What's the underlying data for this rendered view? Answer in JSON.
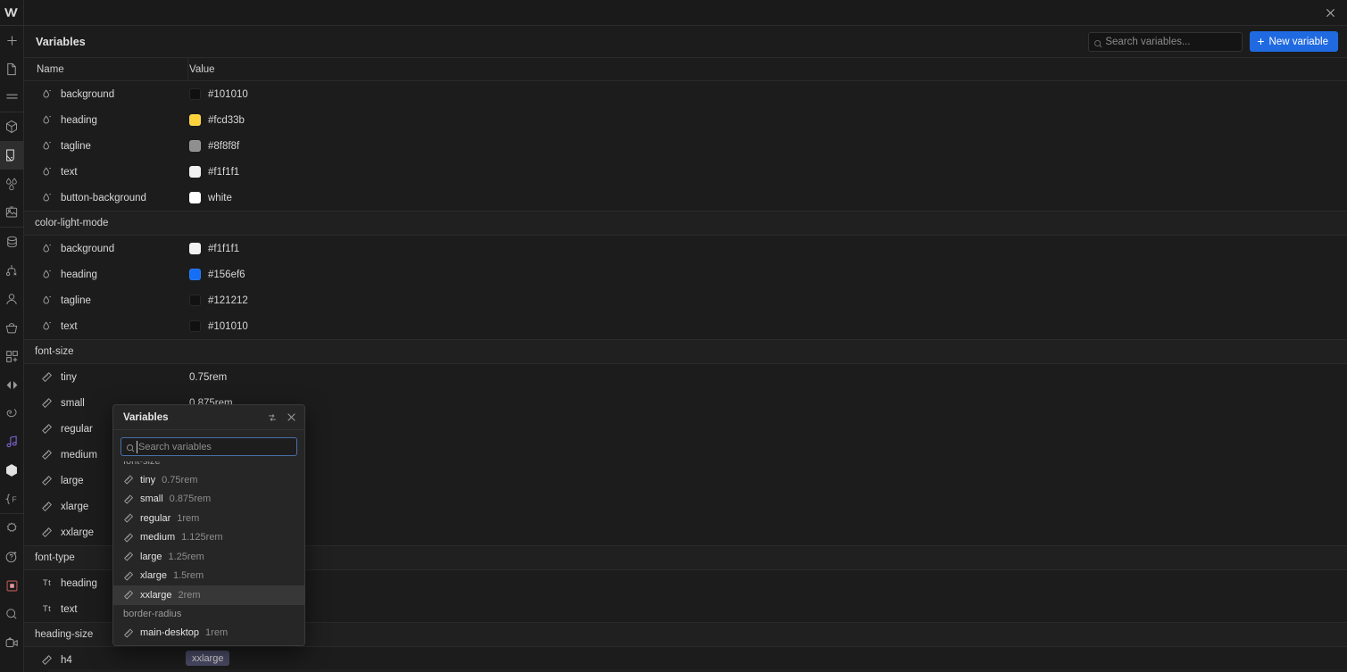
{
  "toolbar": {
    "logo": "webflow-logo",
    "items": [
      {
        "name": "add-element",
        "icon": "plus-icon"
      },
      {
        "name": "pages",
        "icon": "page-icon"
      },
      {
        "name": "navigator",
        "icon": "navigator-icon"
      },
      {
        "name": "components",
        "icon": "cube-icon"
      },
      {
        "name": "style-panel",
        "icon": "paint-brush-icon",
        "active": true
      },
      {
        "name": "variables",
        "icon": "droplets-icon"
      },
      {
        "name": "assets",
        "icon": "image-icon"
      },
      {
        "name": "cms",
        "icon": "database-icon"
      },
      {
        "name": "logic",
        "icon": "logic-icon"
      },
      {
        "name": "users",
        "icon": "person-icon"
      },
      {
        "name": "ecommerce",
        "icon": "basket-icon"
      },
      {
        "name": "apps",
        "icon": "apps-icon"
      },
      {
        "name": "interactions",
        "icon": "interactions-icon"
      },
      {
        "name": "audit",
        "icon": "audit-icon"
      },
      {
        "name": "motion",
        "icon": "motion-icon"
      },
      {
        "name": "libraries",
        "icon": "package-icon"
      },
      {
        "name": "code",
        "icon": "code-brace-icon"
      },
      {
        "name": "ai",
        "icon": "spark-icon"
      },
      {
        "name": "help",
        "icon": "question-plus-icon"
      },
      {
        "name": "video",
        "icon": "video-square-icon"
      },
      {
        "name": "search",
        "icon": "magnifier-icon"
      },
      {
        "name": "video-tutorials",
        "icon": "video-camera-icon"
      }
    ]
  },
  "titlebar": {
    "close_label": "✕"
  },
  "header": {
    "title": "Variables",
    "search_placeholder": "Search variables...",
    "search_value": "",
    "search_icon": "search-icon",
    "new_variable_label": "New variable",
    "new_variable_plus": "+",
    "accent_color": "#206ae1"
  },
  "table": {
    "columns": {
      "name": "Name",
      "value": "Value"
    },
    "groups": [
      {
        "name": "",
        "rows": [
          {
            "icon": "color-variable-icon",
            "name": "background",
            "value": "#101010",
            "swatch": "#101010",
            "type": "color"
          },
          {
            "icon": "color-variable-icon",
            "name": "heading",
            "value": "#fcd33b",
            "swatch": "#fcd33b",
            "type": "color"
          },
          {
            "icon": "color-variable-icon",
            "name": "tagline",
            "value": "#8f8f8f",
            "swatch": "#8f8f8f",
            "type": "color"
          },
          {
            "icon": "color-variable-icon",
            "name": "text",
            "value": "#f1f1f1",
            "swatch": "#f1f1f1",
            "type": "color"
          },
          {
            "icon": "color-variable-icon",
            "name": "button-background",
            "value": "white",
            "swatch": "#ffffff",
            "type": "color"
          }
        ]
      },
      {
        "name": "color-light-mode",
        "rows": [
          {
            "icon": "color-variable-icon",
            "name": "background",
            "value": "#f1f1f1",
            "swatch": "#f1f1f1",
            "type": "color"
          },
          {
            "icon": "color-variable-icon",
            "name": "heading",
            "value": "#156ef6",
            "swatch": "#156ef6",
            "type": "color"
          },
          {
            "icon": "color-variable-icon",
            "name": "tagline",
            "value": "#121212",
            "swatch": "#121212",
            "type": "color"
          },
          {
            "icon": "color-variable-icon",
            "name": "text",
            "value": "#101010",
            "swatch": "#101010",
            "type": "color"
          }
        ]
      },
      {
        "name": "font-size",
        "rows": [
          {
            "icon": "size-variable-icon",
            "name": "tiny",
            "value": "0.75rem",
            "type": "size"
          },
          {
            "icon": "size-variable-icon",
            "name": "small",
            "value": "0.875rem",
            "type": "size"
          },
          {
            "icon": "size-variable-icon",
            "name": "regular",
            "value": "",
            "type": "size"
          },
          {
            "icon": "size-variable-icon",
            "name": "medium",
            "value": "",
            "type": "size"
          },
          {
            "icon": "size-variable-icon",
            "name": "large",
            "value": "",
            "type": "size"
          },
          {
            "icon": "size-variable-icon",
            "name": "xlarge",
            "value": "",
            "type": "size"
          },
          {
            "icon": "size-variable-icon",
            "name": "xxlarge",
            "value": "",
            "type": "size"
          }
        ]
      },
      {
        "name": "font-type",
        "rows": [
          {
            "icon": "font-variable-icon",
            "name": "heading",
            "value": "",
            "type": "font"
          },
          {
            "icon": "font-variable-icon",
            "name": "text",
            "value": "",
            "type": "font"
          }
        ]
      },
      {
        "name": "heading-size",
        "rows": [
          {
            "icon": "size-variable-icon",
            "name": "h4",
            "value": "",
            "type": "size"
          }
        ]
      }
    ]
  },
  "popup": {
    "title": "Variables",
    "swap_icon": "swap-icon",
    "close_icon": "close-icon",
    "search_placeholder": "Search variables",
    "search_value": "",
    "search_icon": "search-icon",
    "list": [
      {
        "kind": "group",
        "label": "font-size"
      },
      {
        "kind": "item",
        "icon": "size-variable-icon",
        "name": "tiny",
        "value": "0.75rem",
        "selected": false
      },
      {
        "kind": "item",
        "icon": "size-variable-icon",
        "name": "small",
        "value": "0.875rem",
        "selected": false
      },
      {
        "kind": "item",
        "icon": "size-variable-icon",
        "name": "regular",
        "value": "1rem",
        "selected": false
      },
      {
        "kind": "item",
        "icon": "size-variable-icon",
        "name": "medium",
        "value": "1.125rem",
        "selected": false
      },
      {
        "kind": "item",
        "icon": "size-variable-icon",
        "name": "large",
        "value": "1.25rem",
        "selected": false
      },
      {
        "kind": "item",
        "icon": "size-variable-icon",
        "name": "xlarge",
        "value": "1.5rem",
        "selected": false
      },
      {
        "kind": "item",
        "icon": "size-variable-icon",
        "name": "xxlarge",
        "value": "2rem",
        "selected": true
      },
      {
        "kind": "group",
        "label": "border-radius"
      },
      {
        "kind": "item",
        "icon": "size-variable-icon",
        "name": "main-desktop",
        "value": "1rem",
        "selected": false
      }
    ]
  },
  "badge": {
    "label": "xxlarge",
    "color": "#4a4a66"
  }
}
